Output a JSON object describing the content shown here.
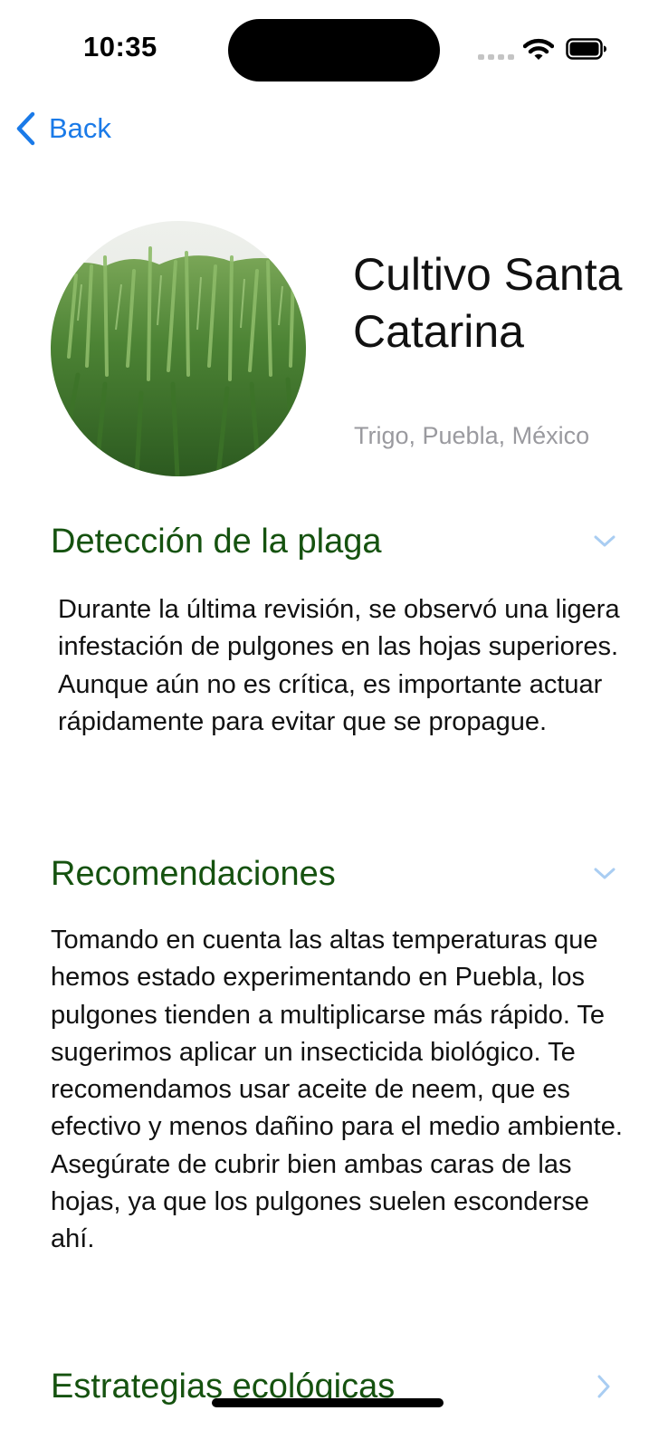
{
  "status_bar": {
    "time": "10:35"
  },
  "nav": {
    "back_label": "Back"
  },
  "crop": {
    "title": "Cultivo Santa Catarina",
    "subtitle": "Trigo, Puebla, México"
  },
  "sections": [
    {
      "title": "Detección de la plaga",
      "expanded": true,
      "body": "Durante la última revisión, se observó una ligera infestación de pulgones en las hojas superiores. Aunque aún no es crítica, es importante actuar rápidamente para evitar que se propague."
    },
    {
      "title": "Recomendaciones",
      "expanded": true,
      "body": "Tomando en cuenta las altas temperaturas que hemos estado experimentando en Puebla, los pulgones tienden a multiplicarse más rápido. Te sugerimos aplicar un insecticida biológico. Te recomendamos usar aceite de neem, que es efectivo y menos dañino para el medio ambiente. Asegúrate de cubrir bien ambas caras de las hojas, ya que los pulgones suelen esconderse ahí."
    },
    {
      "title": "Estrategias ecológicas",
      "expanded": false
    }
  ],
  "colors": {
    "accent_blue": "#1a7ae8",
    "section_green": "#15520f",
    "chevron_light_blue": "#a9cdf2",
    "subtitle_gray": "#9a9a9f"
  },
  "icons": {
    "back": "chevron-left-icon",
    "section_expanded": "chevron-down-icon",
    "section_collapsed": "chevron-right-icon",
    "wifi": "wifi-icon",
    "battery": "battery-icon"
  }
}
